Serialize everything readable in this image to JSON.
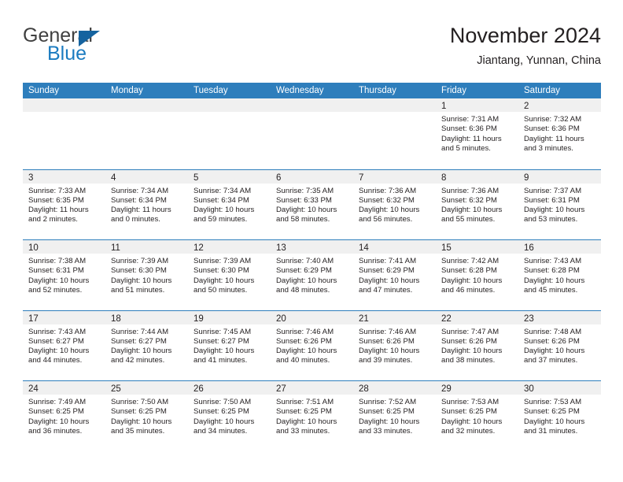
{
  "brand": {
    "name_top": "General",
    "name_bottom": "Blue",
    "logo_icon": "blue-triangle-icon",
    "color_top": "#404040",
    "color_bottom": "#1b7bc0"
  },
  "header": {
    "title": "November 2024",
    "subtitle": "Jiantang, Yunnan, China"
  },
  "theme": {
    "header_blue": "#2e7ebc",
    "day_band_gray": "#f0f0f0",
    "text": "#231f20"
  },
  "calendar": {
    "weekdays": [
      "Sunday",
      "Monday",
      "Tuesday",
      "Wednesday",
      "Thursday",
      "Friday",
      "Saturday"
    ],
    "weeks": [
      [
        {
          "day": "",
          "lines": []
        },
        {
          "day": "",
          "lines": []
        },
        {
          "day": "",
          "lines": []
        },
        {
          "day": "",
          "lines": []
        },
        {
          "day": "",
          "lines": []
        },
        {
          "day": "1",
          "lines": [
            "Sunrise: 7:31 AM",
            "Sunset: 6:36 PM",
            "Daylight: 11 hours",
            "and 5 minutes."
          ]
        },
        {
          "day": "2",
          "lines": [
            "Sunrise: 7:32 AM",
            "Sunset: 6:36 PM",
            "Daylight: 11 hours",
            "and 3 minutes."
          ]
        }
      ],
      [
        {
          "day": "3",
          "lines": [
            "Sunrise: 7:33 AM",
            "Sunset: 6:35 PM",
            "Daylight: 11 hours",
            "and 2 minutes."
          ]
        },
        {
          "day": "4",
          "lines": [
            "Sunrise: 7:34 AM",
            "Sunset: 6:34 PM",
            "Daylight: 11 hours",
            "and 0 minutes."
          ]
        },
        {
          "day": "5",
          "lines": [
            "Sunrise: 7:34 AM",
            "Sunset: 6:34 PM",
            "Daylight: 10 hours",
            "and 59 minutes."
          ]
        },
        {
          "day": "6",
          "lines": [
            "Sunrise: 7:35 AM",
            "Sunset: 6:33 PM",
            "Daylight: 10 hours",
            "and 58 minutes."
          ]
        },
        {
          "day": "7",
          "lines": [
            "Sunrise: 7:36 AM",
            "Sunset: 6:32 PM",
            "Daylight: 10 hours",
            "and 56 minutes."
          ]
        },
        {
          "day": "8",
          "lines": [
            "Sunrise: 7:36 AM",
            "Sunset: 6:32 PM",
            "Daylight: 10 hours",
            "and 55 minutes."
          ]
        },
        {
          "day": "9",
          "lines": [
            "Sunrise: 7:37 AM",
            "Sunset: 6:31 PM",
            "Daylight: 10 hours",
            "and 53 minutes."
          ]
        }
      ],
      [
        {
          "day": "10",
          "lines": [
            "Sunrise: 7:38 AM",
            "Sunset: 6:31 PM",
            "Daylight: 10 hours",
            "and 52 minutes."
          ]
        },
        {
          "day": "11",
          "lines": [
            "Sunrise: 7:39 AM",
            "Sunset: 6:30 PM",
            "Daylight: 10 hours",
            "and 51 minutes."
          ]
        },
        {
          "day": "12",
          "lines": [
            "Sunrise: 7:39 AM",
            "Sunset: 6:30 PM",
            "Daylight: 10 hours",
            "and 50 minutes."
          ]
        },
        {
          "day": "13",
          "lines": [
            "Sunrise: 7:40 AM",
            "Sunset: 6:29 PM",
            "Daylight: 10 hours",
            "and 48 minutes."
          ]
        },
        {
          "day": "14",
          "lines": [
            "Sunrise: 7:41 AM",
            "Sunset: 6:29 PM",
            "Daylight: 10 hours",
            "and 47 minutes."
          ]
        },
        {
          "day": "15",
          "lines": [
            "Sunrise: 7:42 AM",
            "Sunset: 6:28 PM",
            "Daylight: 10 hours",
            "and 46 minutes."
          ]
        },
        {
          "day": "16",
          "lines": [
            "Sunrise: 7:43 AM",
            "Sunset: 6:28 PM",
            "Daylight: 10 hours",
            "and 45 minutes."
          ]
        }
      ],
      [
        {
          "day": "17",
          "lines": [
            "Sunrise: 7:43 AM",
            "Sunset: 6:27 PM",
            "Daylight: 10 hours",
            "and 44 minutes."
          ]
        },
        {
          "day": "18",
          "lines": [
            "Sunrise: 7:44 AM",
            "Sunset: 6:27 PM",
            "Daylight: 10 hours",
            "and 42 minutes."
          ]
        },
        {
          "day": "19",
          "lines": [
            "Sunrise: 7:45 AM",
            "Sunset: 6:27 PM",
            "Daylight: 10 hours",
            "and 41 minutes."
          ]
        },
        {
          "day": "20",
          "lines": [
            "Sunrise: 7:46 AM",
            "Sunset: 6:26 PM",
            "Daylight: 10 hours",
            "and 40 minutes."
          ]
        },
        {
          "day": "21",
          "lines": [
            "Sunrise: 7:46 AM",
            "Sunset: 6:26 PM",
            "Daylight: 10 hours",
            "and 39 minutes."
          ]
        },
        {
          "day": "22",
          "lines": [
            "Sunrise: 7:47 AM",
            "Sunset: 6:26 PM",
            "Daylight: 10 hours",
            "and 38 minutes."
          ]
        },
        {
          "day": "23",
          "lines": [
            "Sunrise: 7:48 AM",
            "Sunset: 6:26 PM",
            "Daylight: 10 hours",
            "and 37 minutes."
          ]
        }
      ],
      [
        {
          "day": "24",
          "lines": [
            "Sunrise: 7:49 AM",
            "Sunset: 6:25 PM",
            "Daylight: 10 hours",
            "and 36 minutes."
          ]
        },
        {
          "day": "25",
          "lines": [
            "Sunrise: 7:50 AM",
            "Sunset: 6:25 PM",
            "Daylight: 10 hours",
            "and 35 minutes."
          ]
        },
        {
          "day": "26",
          "lines": [
            "Sunrise: 7:50 AM",
            "Sunset: 6:25 PM",
            "Daylight: 10 hours",
            "and 34 minutes."
          ]
        },
        {
          "day": "27",
          "lines": [
            "Sunrise: 7:51 AM",
            "Sunset: 6:25 PM",
            "Daylight: 10 hours",
            "and 33 minutes."
          ]
        },
        {
          "day": "28",
          "lines": [
            "Sunrise: 7:52 AM",
            "Sunset: 6:25 PM",
            "Daylight: 10 hours",
            "and 33 minutes."
          ]
        },
        {
          "day": "29",
          "lines": [
            "Sunrise: 7:53 AM",
            "Sunset: 6:25 PM",
            "Daylight: 10 hours",
            "and 32 minutes."
          ]
        },
        {
          "day": "30",
          "lines": [
            "Sunrise: 7:53 AM",
            "Sunset: 6:25 PM",
            "Daylight: 10 hours",
            "and 31 minutes."
          ]
        }
      ]
    ]
  }
}
